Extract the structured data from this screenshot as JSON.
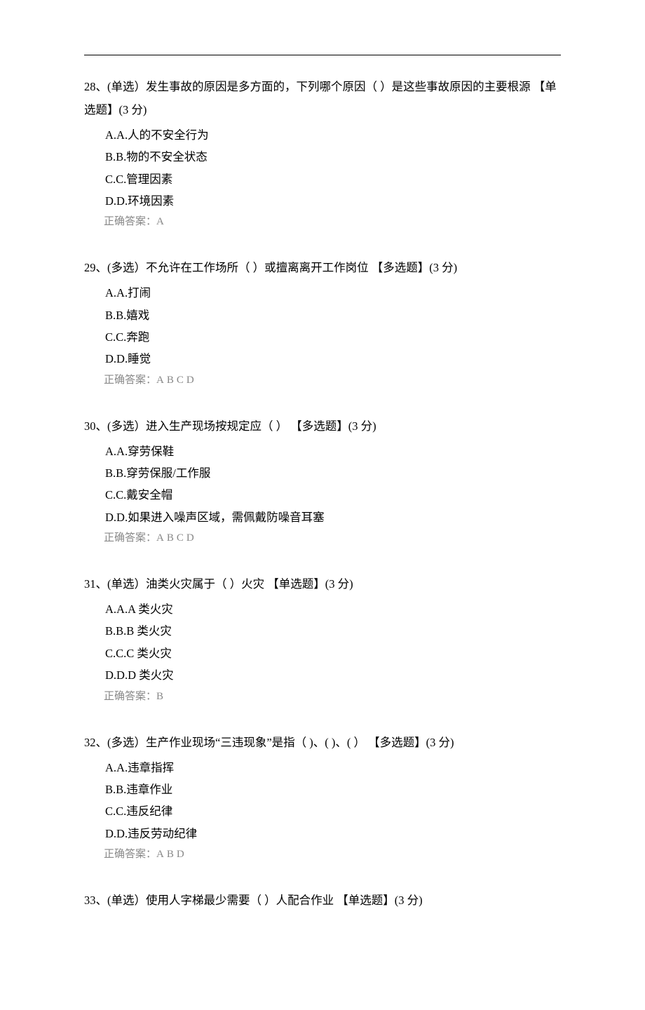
{
  "questions": [
    {
      "number": "28",
      "stem": "28、(单选）发生事故的原因是多方面的，下列哪个原因（  ）是这些事故原因的主要根源  【单选题】(3 分)",
      "options": [
        "A.A.人的不安全行为",
        "B.B.物的不安全状态",
        "C.C.管理因素",
        "D.D.环境因素"
      ],
      "answer_label": "正确答案：",
      "answer_value": "A"
    },
    {
      "number": "29",
      "stem": "29、(多选）不允许在工作场所（   ）或擅离离开工作岗位  【多选题】(3 分)",
      "options": [
        "A.A.打闹",
        "B.B.嬉戏",
        "C.C.奔跑",
        "D.D.睡觉"
      ],
      "answer_label": "正确答案：",
      "answer_value": "ABCD"
    },
    {
      "number": "30",
      "stem": "30、(多选）进入生产现场按规定应（  ）  【多选题】(3 分)",
      "options": [
        "A.A.穿劳保鞋",
        "B.B.穿劳保服/工作服",
        "C.C.戴安全帽",
        "D.D.如果进入噪声区域，需佩戴防噪音耳塞"
      ],
      "answer_label": "正确答案：",
      "answer_value": "ABCD"
    },
    {
      "number": "31",
      "stem": "31、(单选）油类火灾属于（   ）火灾  【单选题】(3 分)",
      "options": [
        "A.A.A 类火灾",
        "B.B.B 类火灾",
        "C.C.C 类火灾",
        "D.D.D 类火灾"
      ],
      "answer_label": "正确答案：",
      "answer_value": "B"
    },
    {
      "number": "32",
      "stem": "32、(多选）生产作业现场“三违现象”是指（  )、(  )、(  ）  【多选题】(3 分)",
      "options": [
        "A.A.违章指挥",
        "B.B.违章作业",
        "C.C.违反纪律",
        "D.D.违反劳动纪律"
      ],
      "answer_label": "正确答案：",
      "answer_value": "ABD"
    },
    {
      "number": "33",
      "stem": "33、(单选）使用人字梯最少需要（  ）人配合作业  【单选题】(3 分)",
      "options": [],
      "answer_label": "",
      "answer_value": ""
    }
  ]
}
